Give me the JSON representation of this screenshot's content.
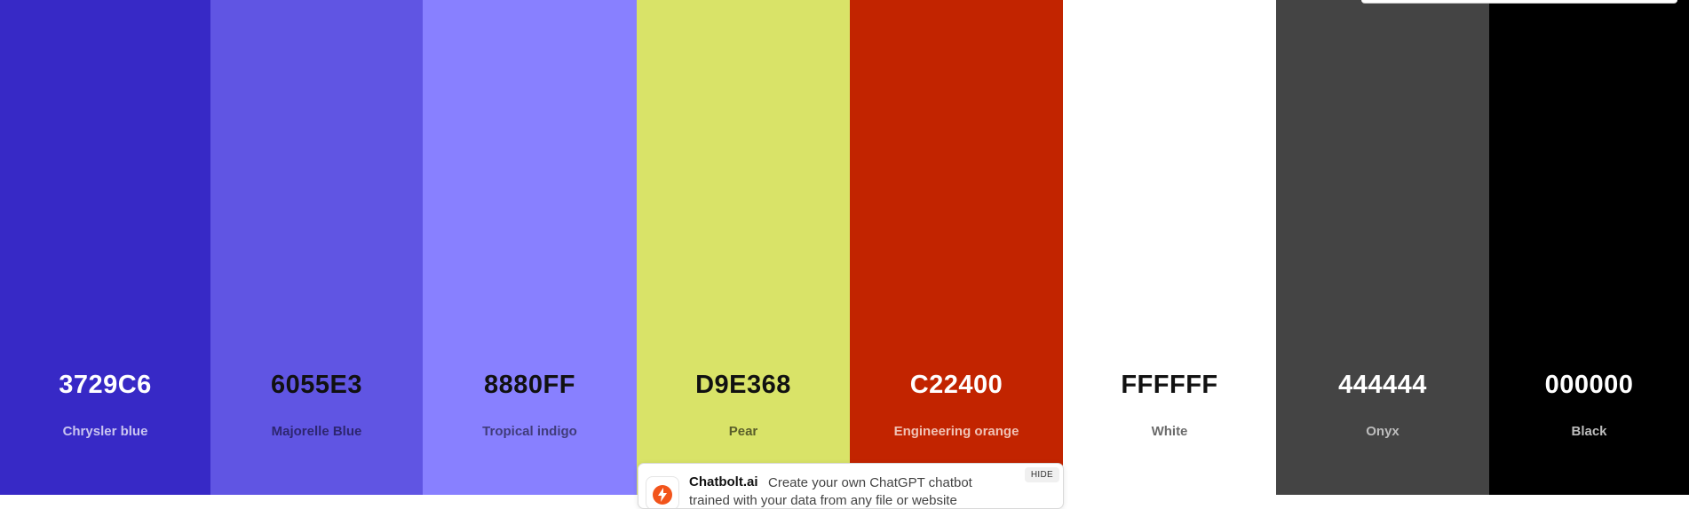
{
  "swatches": [
    {
      "hex": "3729C6",
      "name": "Chrysler blue",
      "bg": "#3729C6",
      "hex_color": "#ffffff",
      "name_color": "#c9c5f0"
    },
    {
      "hex": "6055E3",
      "name": "Majorelle Blue",
      "bg": "#6055E3",
      "hex_color": "#111111",
      "name_color": "#2d2670"
    },
    {
      "hex": "8880FF",
      "name": "Tropical indigo",
      "bg": "#8880FF",
      "hex_color": "#111111",
      "name_color": "#403c7a"
    },
    {
      "hex": "D9E368",
      "name": "Pear",
      "bg": "#D9E368",
      "hex_color": "#111111",
      "name_color": "#5a5e2a"
    },
    {
      "hex": "C22400",
      "name": "Engineering orange",
      "bg": "#C22400",
      "hex_color": "#ffffff",
      "name_color": "#f0c2b5"
    },
    {
      "hex": "FFFFFF",
      "name": "White",
      "bg": "#FFFFFF",
      "hex_color": "#111111",
      "name_color": "#6b6b6b"
    },
    {
      "hex": "444444",
      "name": "Onyx",
      "bg": "#444444",
      "hex_color": "#ffffff",
      "name_color": "#bdbdbd"
    },
    {
      "hex": "000000",
      "name": "Black",
      "bg": "#000000",
      "hex_color": "#ffffff",
      "name_color": "#bdbdbd"
    }
  ],
  "ad": {
    "brand": "Chatbolt.ai",
    "text": "Create your own ChatGPT chatbot trained with your data from any file or website",
    "hide_label": "HIDE",
    "logo_icon": "lightning-bolt-icon",
    "logo_color": "#F2541B"
  }
}
